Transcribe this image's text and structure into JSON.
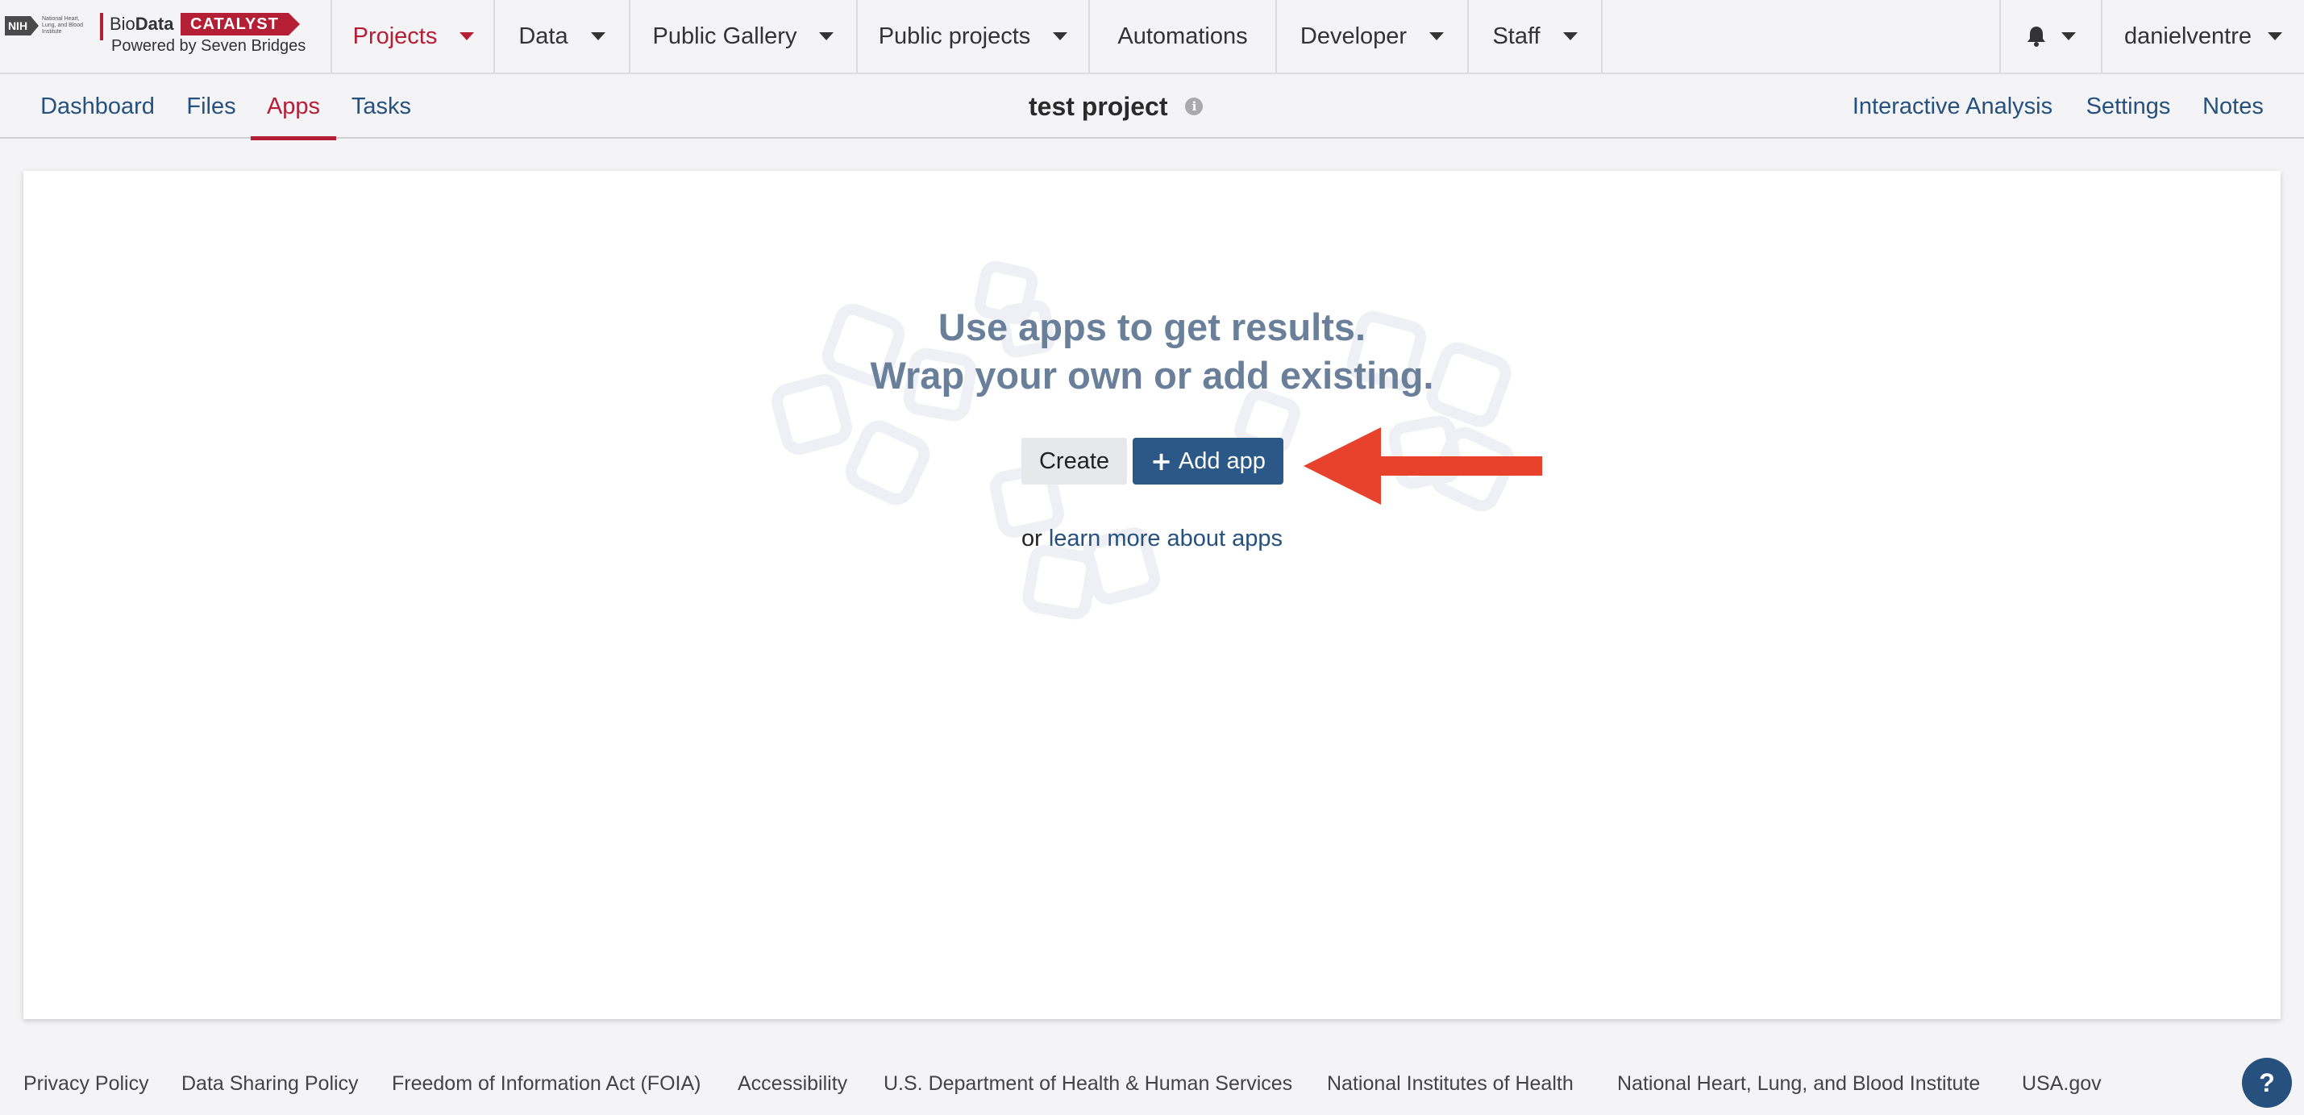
{
  "logo": {
    "nih": "NIH",
    "nih_institute": "National Heart, Lung, and Blood Institute",
    "brand_prefix": "Bio",
    "brand_bold": "Data",
    "brand_badge": "CATALYST",
    "brand_sub": "Powered by Seven Bridges"
  },
  "topnav": {
    "items": [
      {
        "label": "Projects",
        "active": true
      },
      {
        "label": "Data"
      },
      {
        "label": "Public Gallery"
      },
      {
        "label": "Public projects"
      },
      {
        "label": "Automations"
      },
      {
        "label": "Developer"
      },
      {
        "label": "Staff"
      }
    ],
    "notifications_icon": "bell-icon",
    "user": "danielventre"
  },
  "subnav": {
    "left_tabs": [
      "Dashboard",
      "Files",
      "Apps",
      "Tasks"
    ],
    "active_tab": "Apps",
    "project_title": "test project",
    "info_icon": "i",
    "right_tabs": [
      "Interactive Analysis",
      "Settings",
      "Notes"
    ]
  },
  "main": {
    "headline_line1": "Use apps to get results.",
    "headline_line2": "Wrap your own or add existing.",
    "create_label": "Create",
    "add_app_icon": "+",
    "add_app_label": "Add app",
    "learn_prefix": "or",
    "learn_link": "learn more about apps"
  },
  "footer": {
    "links": [
      "Privacy Policy",
      "Data Sharing Policy",
      "Freedom of Information Act (FOIA)",
      "Accessibility",
      "U.S. Department of Health & Human Services",
      "National Institutes of Health",
      "National Heart, Lung, and Blood Institute",
      "USA.gov"
    ],
    "help_label": "?"
  },
  "colors": {
    "accent_red": "#b41f36",
    "link_blue": "#26507d",
    "primary_button": "#2c5888",
    "headline_gray": "#6a7f99",
    "annotation_arrow": "#e8412c"
  }
}
